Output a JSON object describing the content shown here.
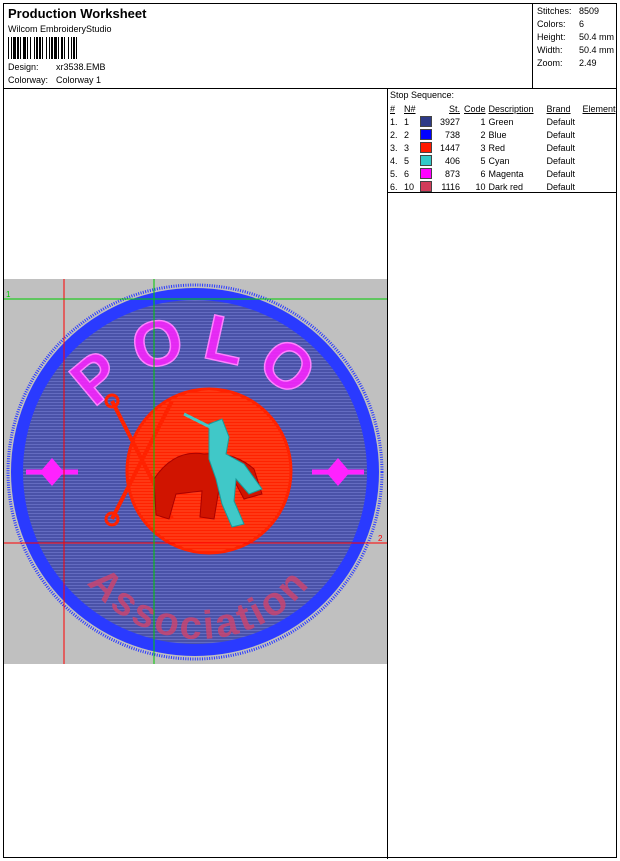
{
  "header": {
    "title": "Production Worksheet",
    "subtitle": "Wilcom EmbroideryStudio",
    "design_label": "Design:",
    "design_value": "xr3538.EMB",
    "colorway_label": "Colorway:",
    "colorway_value": "Colorway 1"
  },
  "stats": [
    {
      "label": "Stitches:",
      "value": "8509"
    },
    {
      "label": "Colors:",
      "value": "6"
    },
    {
      "label": "Height:",
      "value": "50.4 mm"
    },
    {
      "label": "Width:",
      "value": "50.4 mm"
    },
    {
      "label": "Zoom:",
      "value": "2.49"
    }
  ],
  "stop_sequence": {
    "title": "Stop Sequence:",
    "columns": [
      "#",
      "N#",
      "St.",
      "Code",
      "Description",
      "Brand",
      "Element"
    ],
    "rows": [
      {
        "idx": "1.",
        "n": "1",
        "color": "#2e3a87",
        "st": "3927",
        "code": "1",
        "desc": "Green",
        "brand": "Default",
        "element": ""
      },
      {
        "idx": "2.",
        "n": "2",
        "color": "#0000ff",
        "st": "738",
        "code": "2",
        "desc": "Blue",
        "brand": "Default",
        "element": ""
      },
      {
        "idx": "3.",
        "n": "3",
        "color": "#ff1a00",
        "st": "1447",
        "code": "3",
        "desc": "Red",
        "brand": "Default",
        "element": ""
      },
      {
        "idx": "4.",
        "n": "5",
        "color": "#33c9c9",
        "st": "406",
        "code": "5",
        "desc": "Cyan",
        "brand": "Default",
        "element": ""
      },
      {
        "idx": "5.",
        "n": "6",
        "color": "#ff00ff",
        "st": "873",
        "code": "6",
        "desc": "Magenta",
        "brand": "Default",
        "element": ""
      },
      {
        "idx": "6.",
        "n": "10",
        "color": "#d23c5a",
        "st": "1116",
        "code": "10",
        "desc": "Dark red",
        "brand": "Default",
        "element": ""
      }
    ]
  },
  "design": {
    "top_text": "POLO",
    "bottom_text": "Association",
    "guide_labels": [
      "1",
      "2"
    ],
    "colors": {
      "background": "#c0c0c0",
      "fill": "#4a52a8",
      "border": "#2a3aff",
      "magenta": "#ff22ff",
      "red": "#ff2200",
      "cyan": "#40c8c8",
      "darkred": "#d0446a",
      "guide_red": "#ff0000",
      "guide_green": "#00cc00"
    }
  }
}
